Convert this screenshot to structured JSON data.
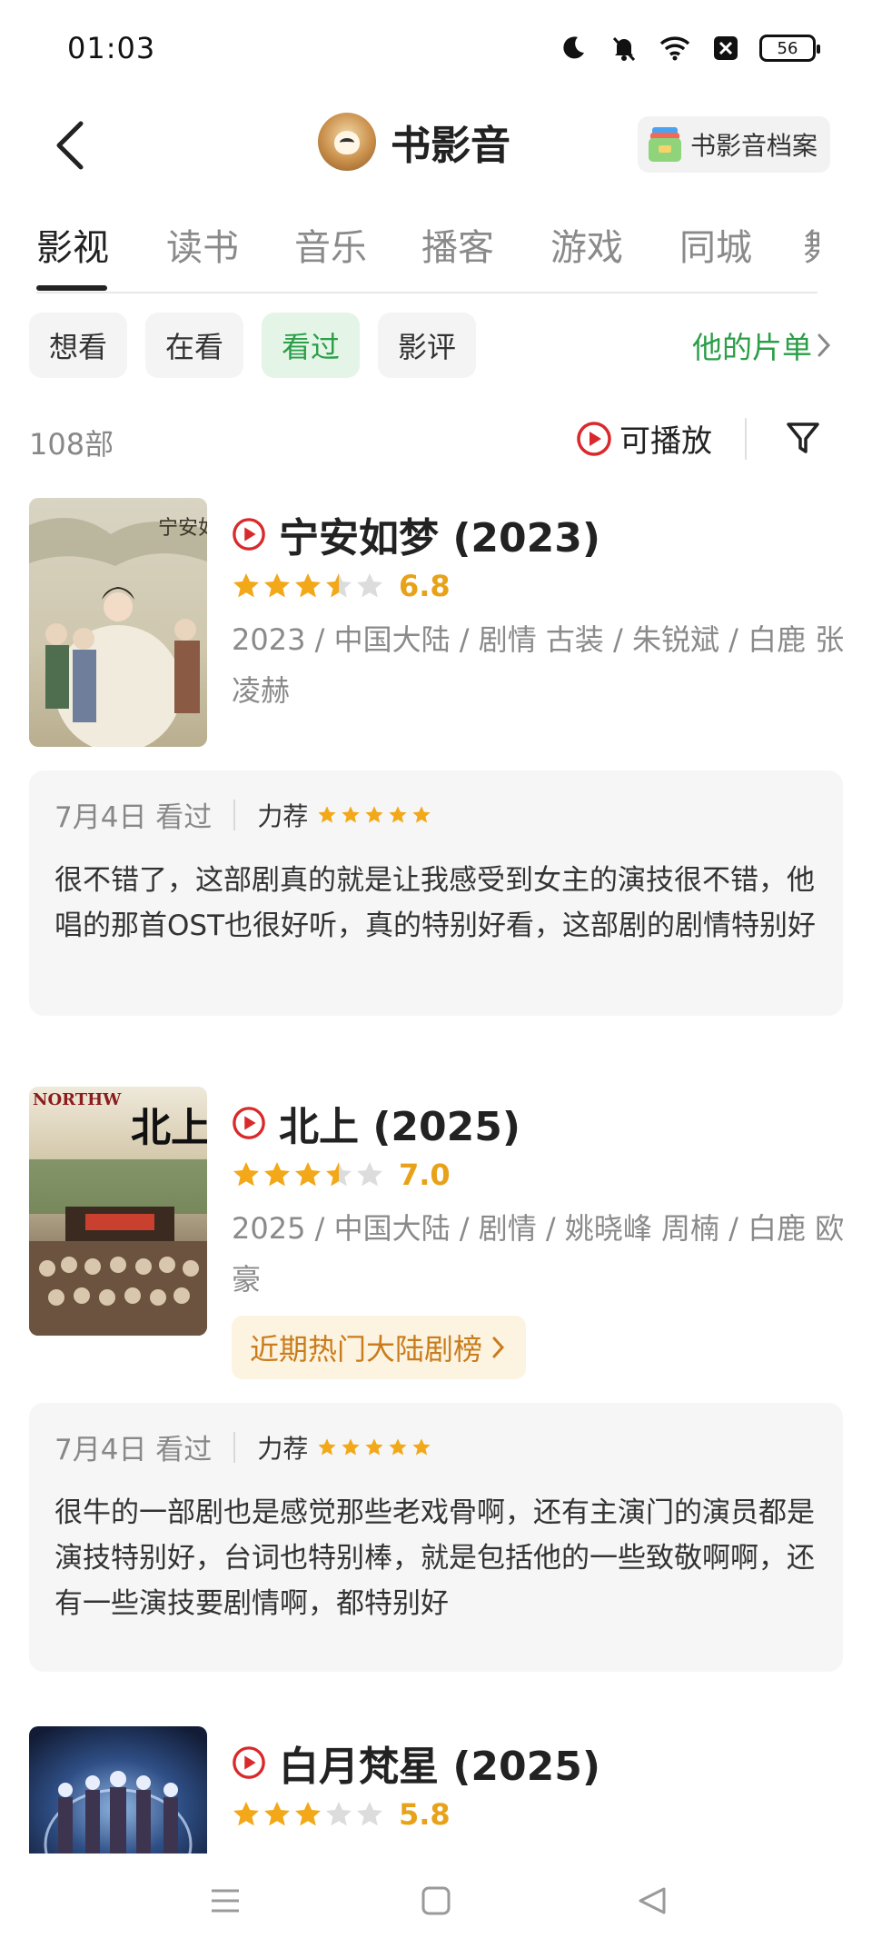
{
  "status_bar": {
    "time": "01:03",
    "battery": "56",
    "icons": [
      "moon-icon",
      "mute-icon",
      "wifi-icon",
      "notification-x-icon",
      "battery-icon"
    ]
  },
  "header": {
    "title": "书影音",
    "archive_label": "书影音档案",
    "back_icon": "chevron-left-icon"
  },
  "tabs": [
    "影视",
    "读书",
    "音乐",
    "播客",
    "游戏",
    "同城",
    "舞"
  ],
  "active_tab": "影视",
  "filters": [
    "想看",
    "在看",
    "看过",
    "影评"
  ],
  "active_filter": "看过",
  "his_list_label": "他的片单",
  "count": "108部",
  "playable_label": "可播放",
  "colors": {
    "green": "#2b9e47",
    "star": "#f2a818",
    "star_empty": "#dcdcdc",
    "play_red": "#d9292b",
    "tag_text": "#c97c1b"
  },
  "movies": [
    {
      "title": "宁安如梦 (2023)",
      "stars": 3.5,
      "rating": "6.8",
      "meta": "2023 / 中国大陆 / 剧情 古装 / 朱锐斌 / 白鹿 张凌赫",
      "review": {
        "date": "7月4日 看过",
        "level": "力荐",
        "stars": 5,
        "text": "很不错了，这部剧真的就是让我感受到女主的演技很不错，他唱的那首OST也很好听，真的特别好看，这部剧的剧情特别好"
      }
    },
    {
      "title": "北上 (2025)",
      "stars": 3.5,
      "rating": "7.0",
      "meta": "2025 / 中国大陆 / 剧情 / 姚晓峰 周楠 / 白鹿 欧豪",
      "poster_label": "NORTHW",
      "poster_title": "北上",
      "ranking_tag": "近期热门大陆剧榜",
      "review": {
        "date": "7月4日 看过",
        "level": "力荐",
        "stars": 5,
        "text": "很牛的一部剧也是感觉那些老戏骨啊，还有主演门的演员都是演技特别好，台词也特别棒，就是包括他的一些致敬啊啊，还有一些演技要剧情啊，都特别好"
      }
    },
    {
      "title": "白月梵星 (2025)",
      "stars": 3,
      "rating": "5.8"
    }
  ],
  "bottom_nav": [
    "menu-icon",
    "home-square-icon",
    "back-triangle-icon"
  ]
}
